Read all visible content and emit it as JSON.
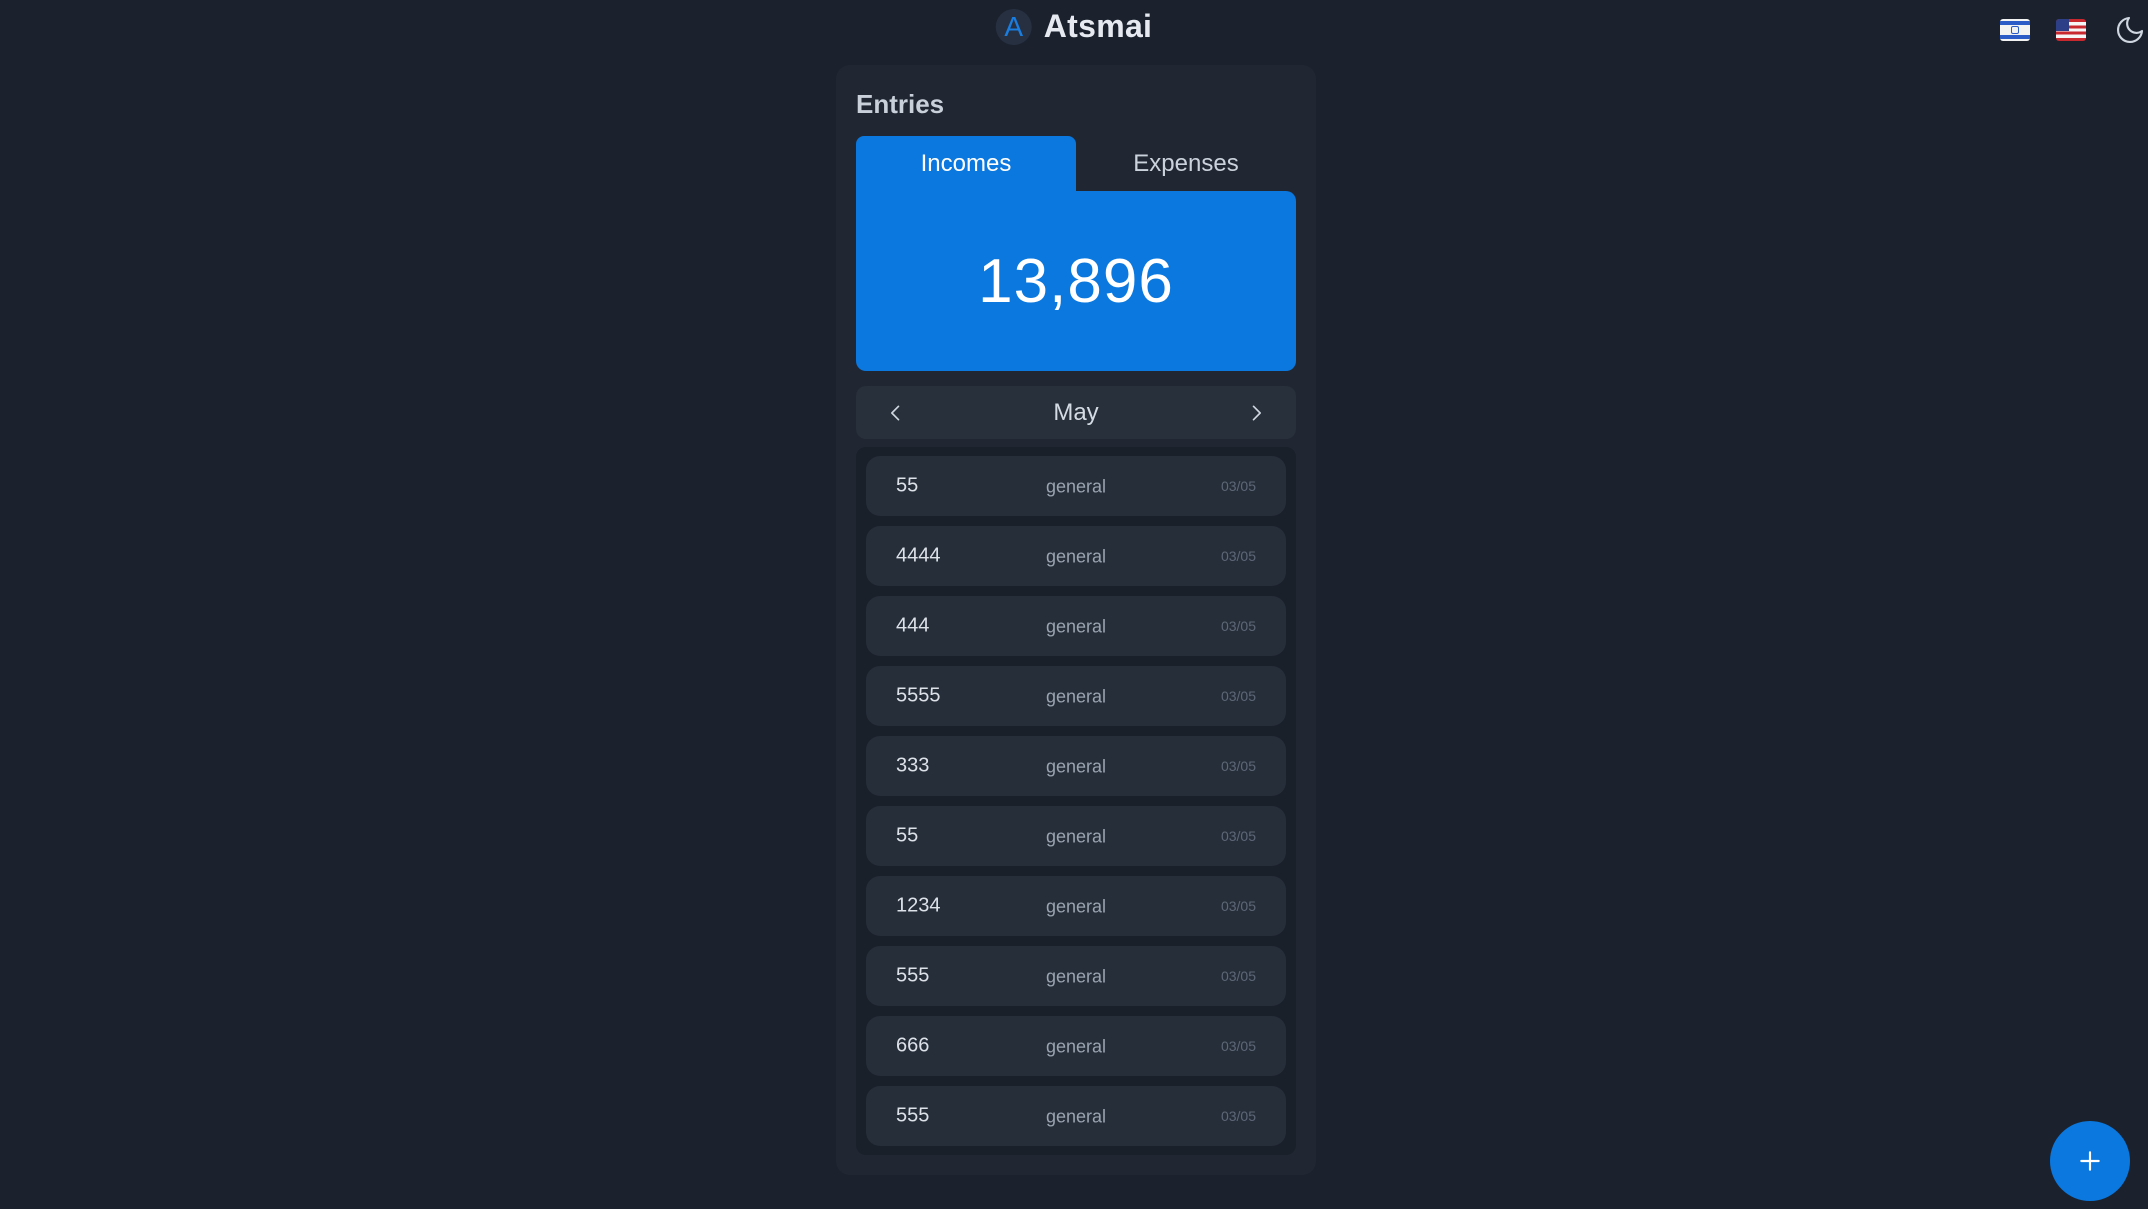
{
  "app": {
    "name": "Atsmai",
    "logo_letter": "A"
  },
  "header": {
    "language_options": [
      {
        "name": "hebrew",
        "icon": "israel-flag-icon"
      },
      {
        "name": "english",
        "icon": "us-flag-icon"
      }
    ],
    "theme_toggle_icon": "moon-icon"
  },
  "entries_card": {
    "title": "Entries",
    "tabs": [
      {
        "label": "Incomes",
        "active": true
      },
      {
        "label": "Expenses",
        "active": false
      }
    ],
    "total": "13,896",
    "month": "May",
    "items": [
      {
        "amount": "55",
        "category": "general",
        "date": "03/05"
      },
      {
        "amount": "4444",
        "category": "general",
        "date": "03/05"
      },
      {
        "amount": "444",
        "category": "general",
        "date": "03/05"
      },
      {
        "amount": "5555",
        "category": "general",
        "date": "03/05"
      },
      {
        "amount": "333",
        "category": "general",
        "date": "03/05"
      },
      {
        "amount": "55",
        "category": "general",
        "date": "03/05"
      },
      {
        "amount": "1234",
        "category": "general",
        "date": "03/05"
      },
      {
        "amount": "555",
        "category": "general",
        "date": "03/05"
      },
      {
        "amount": "666",
        "category": "general",
        "date": "03/05"
      },
      {
        "amount": "555",
        "category": "general",
        "date": "03/05"
      }
    ]
  },
  "fab": {
    "icon": "plus-icon"
  },
  "colors": {
    "background": "#1b222e",
    "card": "#202733",
    "accent": "#0a78de",
    "entry": "#262e3a"
  }
}
